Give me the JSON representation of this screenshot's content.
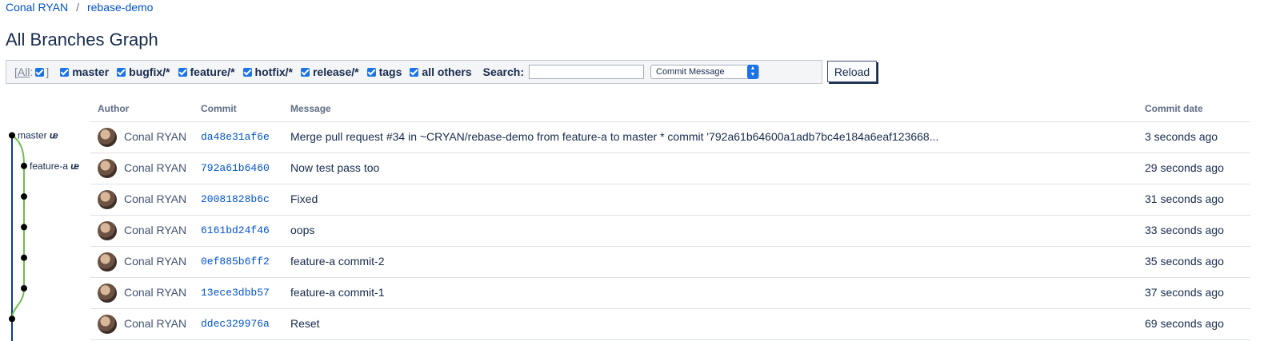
{
  "breadcrumb": {
    "owner": "Conal RYAN",
    "separator": "/",
    "repo": "rebase-demo"
  },
  "page_title": "All Branches Graph",
  "filters": {
    "all_label": "All",
    "all_open": "[",
    "all_colon": ":",
    "all_close": "]",
    "items": [
      {
        "label": "master",
        "checked": true
      },
      {
        "label": "bugfix/*",
        "checked": true
      },
      {
        "label": "feature/*",
        "checked": true
      },
      {
        "label": "hotfix/*",
        "checked": true
      },
      {
        "label": "release/*",
        "checked": true
      },
      {
        "label": "tags",
        "checked": true
      },
      {
        "label": "all others",
        "checked": true
      }
    ],
    "search_label": "Search:",
    "search_value": "",
    "search_mode": "Commit Message",
    "reload_label": "Reload"
  },
  "table": {
    "headers": {
      "author": "Author",
      "commit": "Commit",
      "message": "Message",
      "date": "Commit date"
    },
    "rows": [
      {
        "author": "Conal RYAN",
        "commit": "da48e31af6e",
        "message": "Merge pull request #34 in ~CRYAN/rebase-demo from feature-a to master * commit '792a61b64600a1adb7bc4e184a6eaf123668...",
        "date": "3 seconds ago"
      },
      {
        "author": "Conal RYAN",
        "commit": "792a61b6460",
        "message": "Now test pass too",
        "date": "29 seconds ago"
      },
      {
        "author": "Conal RYAN",
        "commit": "20081828b6c",
        "message": "Fixed",
        "date": "31 seconds ago"
      },
      {
        "author": "Conal RYAN",
        "commit": "6161bd24f46",
        "message": "oops",
        "date": "33 seconds ago"
      },
      {
        "author": "Conal RYAN",
        "commit": "0ef885b6ff2",
        "message": "feature-a commit-2",
        "date": "35 seconds ago"
      },
      {
        "author": "Conal RYAN",
        "commit": "13ece3dbb57",
        "message": "feature-a commit-1",
        "date": "37 seconds ago"
      },
      {
        "author": "Conal RYAN",
        "commit": "ddec329976a",
        "message": "Reset",
        "date": "69 seconds ago"
      }
    ]
  },
  "graph": {
    "branch_labels": [
      {
        "name": "master",
        "row": 0
      },
      {
        "name": "feature-a",
        "row": 1
      }
    ],
    "colors": {
      "master": "#0b3d91",
      "feature": "#6cc04a",
      "node": "#000000"
    },
    "branch_icon": "branch-icon"
  }
}
